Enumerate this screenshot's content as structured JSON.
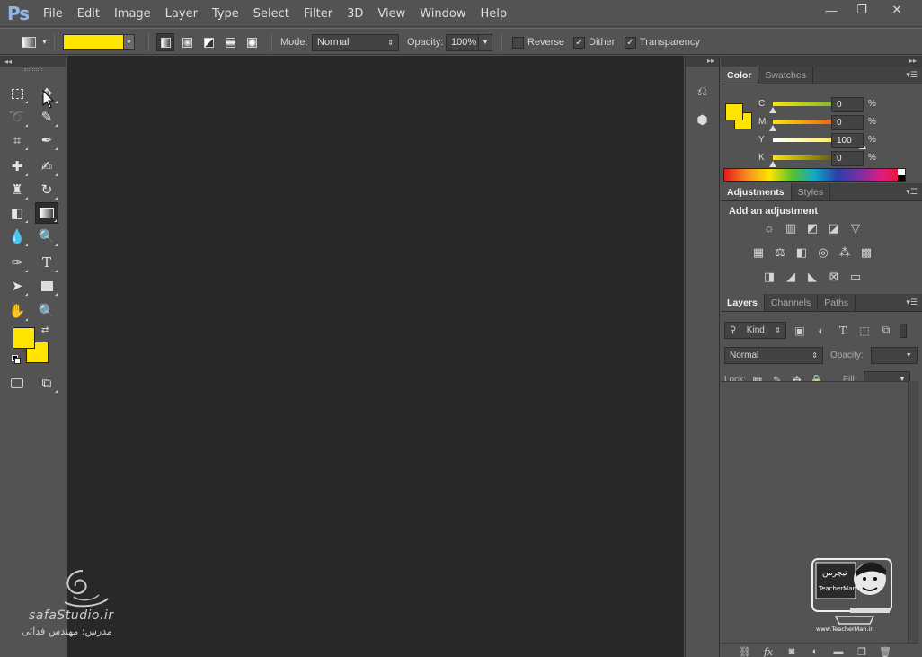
{
  "app": {
    "logo": "Ps",
    "menu": [
      "File",
      "Edit",
      "Image",
      "Layer",
      "Type",
      "Select",
      "Filter",
      "3D",
      "View",
      "Window",
      "Help"
    ],
    "window_controls": {
      "minimize": "—",
      "restore": "❐",
      "close": "✕"
    }
  },
  "options_bar": {
    "gradient_color": "#ffe400",
    "mode_label": "Mode:",
    "mode_value": "Normal",
    "opacity_label": "Opacity:",
    "opacity_value": "100%",
    "reverse_label": "Reverse",
    "reverse_checked": false,
    "dither_label": "Dither",
    "dither_checked": true,
    "transparency_label": "Transparency",
    "transparency_checked": true
  },
  "toolbar": {
    "collapse": "◂◂",
    "active_tool": "gradient-tool",
    "foreground_color": "#ffe400",
    "background_color": "#ffe400"
  },
  "watermark_left": {
    "site": "safaStudio.ir",
    "teacher": "مدرس: مهندس فدائی"
  },
  "watermark_right": {
    "brand": "TeacherMan",
    "url": "www.TeacherMan.ir"
  },
  "dock": {
    "collapse": "▸▸"
  },
  "color_panel": {
    "tabs": [
      "Color",
      "Swatches"
    ],
    "active_tab": "Color",
    "channels": [
      {
        "label": "C",
        "value": "0",
        "unit": "%"
      },
      {
        "label": "M",
        "value": "0",
        "unit": "%"
      },
      {
        "label": "Y",
        "value": "100",
        "unit": "%"
      },
      {
        "label": "K",
        "value": "0",
        "unit": "%"
      }
    ]
  },
  "adjustments_panel": {
    "tabs": [
      "Adjustments",
      "Styles"
    ],
    "active_tab": "Adjustments",
    "title": "Add an adjustment"
  },
  "layers_panel": {
    "tabs": [
      "Layers",
      "Channels",
      "Paths"
    ],
    "active_tab": "Layers",
    "filter_label": "Kind",
    "blend_mode": "Normal",
    "opacity_label": "Opacity:",
    "lock_label": "Lock:",
    "fill_label": "Fill:"
  }
}
